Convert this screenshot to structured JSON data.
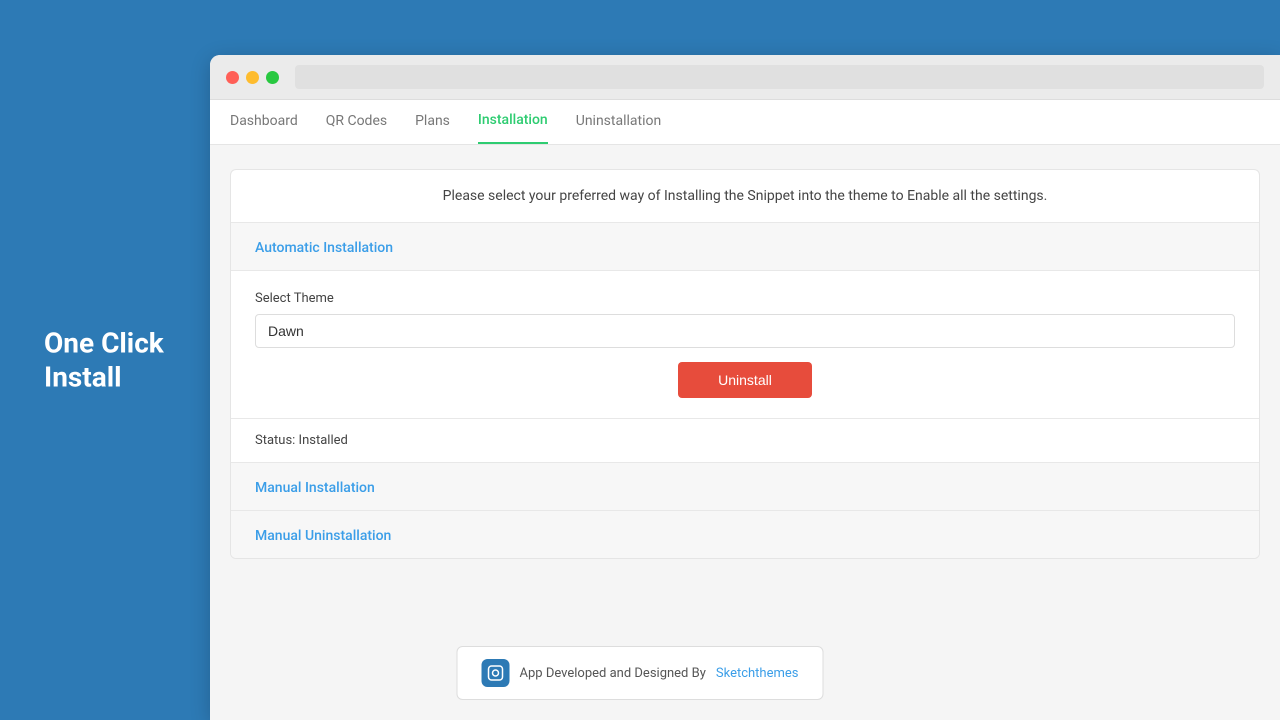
{
  "sidebar": {
    "title_line1": "One Click",
    "title_line2": "Install"
  },
  "browser": {
    "traffic_lights": [
      "red",
      "yellow",
      "green"
    ]
  },
  "nav": {
    "items": [
      {
        "label": "Dashboard",
        "active": false
      },
      {
        "label": "QR Codes",
        "active": false
      },
      {
        "label": "Plans",
        "active": false
      },
      {
        "label": "Installation",
        "active": true
      },
      {
        "label": "Uninstallation",
        "active": false
      }
    ]
  },
  "main": {
    "description": "Please select your preferred way of Installing the Snippet into the theme to Enable all the settings.",
    "automatic_installation_label": "Automatic Installation",
    "select_theme_label": "Select Theme",
    "theme_input_value": "Dawn",
    "uninstall_button": "Uninstall",
    "status_text": "Status: Installed",
    "manual_installation_label": "Manual Installation",
    "manual_uninstallation_label": "Manual Uninstallation"
  },
  "footer": {
    "credit_text": "App Developed and Designed By",
    "credit_link": "Sketchthemes"
  }
}
